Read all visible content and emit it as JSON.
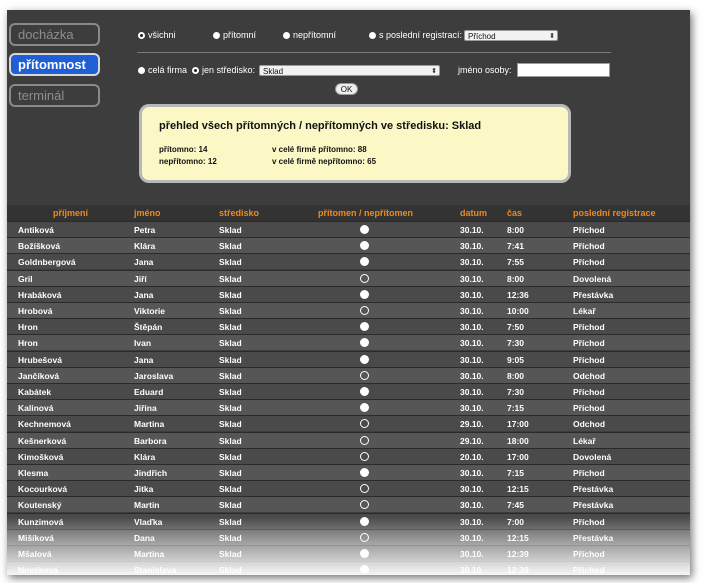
{
  "nav": {
    "items": [
      {
        "label": "docházka",
        "active": false
      },
      {
        "label": "přítomnost",
        "active": true
      },
      {
        "label": "terminál",
        "active": false
      }
    ]
  },
  "filters": {
    "presence_options": [
      {
        "label": "všichni",
        "checked": true
      },
      {
        "label": "přítomní",
        "checked": false
      },
      {
        "label": "nepřítomní",
        "checked": false
      },
      {
        "label": "s poslední registrací:",
        "checked": false
      }
    ],
    "registration_select": "Příchod",
    "scope_options": [
      {
        "label": "celá firma",
        "checked": false
      },
      {
        "label": "jen středisko:",
        "checked": true
      }
    ],
    "center_select": "Sklad",
    "person_label": "jméno osoby:",
    "person_value": "",
    "ok_label": "OK"
  },
  "summary": {
    "title": "přehled všech přítomných / nepřítomných ve středisku: Sklad",
    "present": "přítomno: 14",
    "absent": "nepřítomno: 12",
    "company_present": "v celé firmě přítomno: 88",
    "company_absent": "v celé firmě nepřítomno: 65"
  },
  "table": {
    "columns": [
      "příjmení",
      "jméno",
      "středisko",
      "přítomen / nepřítomen",
      "datum",
      "čas",
      "poslední registrace"
    ],
    "rows": [
      {
        "surname": "Antiková",
        "name": "Petra",
        "center": "Sklad",
        "present": true,
        "date": "30.10.",
        "time": "8:00",
        "reg": "Příchod"
      },
      {
        "surname": "Božíšková",
        "name": "Klára",
        "center": "Sklad",
        "present": true,
        "date": "30.10.",
        "time": "7:41",
        "reg": "Příchod"
      },
      {
        "surname": "Goldnbergová",
        "name": "Jana",
        "center": "Sklad",
        "present": true,
        "date": "30.10.",
        "time": "7:55",
        "reg": "Příchod"
      },
      {
        "surname": "Gril",
        "name": "Jiří",
        "center": "Sklad",
        "present": false,
        "date": "30.10.",
        "time": "8:00",
        "reg": "Dovolená"
      },
      {
        "surname": "Hrabáková",
        "name": "Jana",
        "center": "Sklad",
        "present": true,
        "date": "30.10.",
        "time": "12:36",
        "reg": "Přestávka"
      },
      {
        "surname": "Hrobová",
        "name": "Viktorie",
        "center": "Sklad",
        "present": false,
        "date": "30.10.",
        "time": "10:00",
        "reg": "Lékař"
      },
      {
        "surname": "Hron",
        "name": "Štěpán",
        "center": "Sklad",
        "present": true,
        "date": "30.10.",
        "time": "7:50",
        "reg": "Příchod"
      },
      {
        "surname": "Hron",
        "name": "Ivan",
        "center": "Sklad",
        "present": true,
        "date": "30.10.",
        "time": "7:30",
        "reg": "Příchod"
      },
      {
        "surname": "Hrubešová",
        "name": "Jana",
        "center": "Sklad",
        "present": true,
        "date": "30.10.",
        "time": "9:05",
        "reg": "Příchod"
      },
      {
        "surname": "Jančíková",
        "name": "Jaroslava",
        "center": "Sklad",
        "present": false,
        "date": "30.10.",
        "time": "8:00",
        "reg": "Odchod"
      },
      {
        "surname": "Kabátek",
        "name": "Eduard",
        "center": "Sklad",
        "present": true,
        "date": "30.10.",
        "time": "7:30",
        "reg": "Příchod"
      },
      {
        "surname": "Kalinová",
        "name": "Jiřina",
        "center": "Sklad",
        "present": true,
        "date": "30.10.",
        "time": "7:15",
        "reg": "Příchod"
      },
      {
        "surname": "Kechnemová",
        "name": "Martina",
        "center": "Sklad",
        "present": false,
        "date": "29.10.",
        "time": "17:00",
        "reg": "Odchod"
      },
      {
        "surname": "Kešnerková",
        "name": "Barbora",
        "center": "Sklad",
        "present": false,
        "date": "29.10.",
        "time": "18:00",
        "reg": "Lékař"
      },
      {
        "surname": "Kimošková",
        "name": "Klára",
        "center": "Sklad",
        "present": false,
        "date": "20.10.",
        "time": "17:00",
        "reg": "Dovolená"
      },
      {
        "surname": "Klesma",
        "name": "Jindřich",
        "center": "Sklad",
        "present": true,
        "date": "30.10.",
        "time": "7:15",
        "reg": "Příchod"
      },
      {
        "surname": "Kocourková",
        "name": "Jitka",
        "center": "Sklad",
        "present": false,
        "date": "30.10.",
        "time": "12:15",
        "reg": "Přestávka"
      },
      {
        "surname": "Koutenský",
        "name": "Martin",
        "center": "Sklad",
        "present": false,
        "date": "30.10.",
        "time": "7:45",
        "reg": "Přestávka"
      },
      {
        "surname": "Kunzimová",
        "name": "Vlaďka",
        "center": "Sklad",
        "present": true,
        "date": "30.10.",
        "time": "7:00",
        "reg": "Příchod"
      },
      {
        "surname": "Mišíková",
        "name": "Dana",
        "center": "Sklad",
        "present": false,
        "date": "30.10.",
        "time": "12:15",
        "reg": "Přestávka"
      },
      {
        "surname": "Mšalová",
        "name": "Martina",
        "center": "Sklad",
        "present": true,
        "date": "30.10.",
        "time": "12:39",
        "reg": "Příchod"
      },
      {
        "surname": "Nováková",
        "name": "Stanislava",
        "center": "Sklad",
        "present": true,
        "date": "30.10.",
        "time": "12:39",
        "reg": "Příchod"
      }
    ]
  }
}
